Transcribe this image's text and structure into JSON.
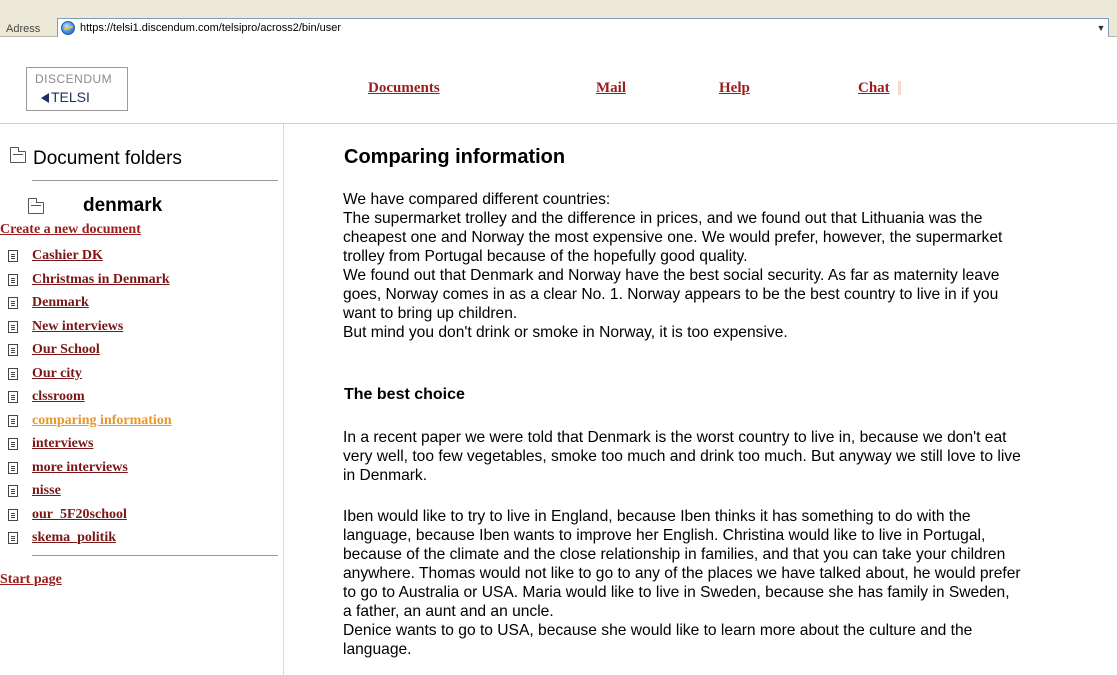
{
  "browser": {
    "address_label": "Adress",
    "url": "https://telsi1.discendum.com/telsipro/across2/bin/user"
  },
  "header": {
    "logo": {
      "line1": "DISCENDUM",
      "line2": "TELSI"
    },
    "nav": [
      {
        "label": "Documents"
      },
      {
        "label": "Mail"
      },
      {
        "label": "Help"
      },
      {
        "label": "Chat"
      }
    ]
  },
  "sidebar": {
    "title": "Document folders",
    "current_folder": "denmark",
    "create_link": "Create a new document",
    "documents": [
      {
        "label": "Cashier DK",
        "active": false
      },
      {
        "label": "Christmas in Denmark",
        "active": false
      },
      {
        "label": "Denmark",
        "active": false
      },
      {
        "label": "New interviews",
        "active": false
      },
      {
        "label": "Our School",
        "active": false
      },
      {
        "label": "Our city",
        "active": false
      },
      {
        "label": "clssroom",
        "active": false
      },
      {
        "label": "comparing information",
        "active": true
      },
      {
        "label": "interviews",
        "active": false
      },
      {
        "label": "more interviews",
        "active": false
      },
      {
        "label": "nisse",
        "active": false
      },
      {
        "label": "our_5F20school",
        "active": false
      },
      {
        "label": "skema_politik",
        "active": false
      }
    ],
    "start_link": "Start page"
  },
  "article": {
    "title": "Comparing information",
    "intro": [
      "We have compared different countries:",
      "The supermarket trolley and the difference in prices, and we found out that Lithuania was the",
      "cheapest one and Norway the most expensive one. We would prefer, however, the supermarket",
      "trolley from Portugal because of the hopefully good quality.",
      "We found out that Denmark and Norway have the best social security. As far as maternity leave",
      "goes, Norway comes in as a clear No. 1. Norway appears to be the best country to live in if you",
      "want to bring up children.",
      "But mind you don't drink or smoke in Norway, it is too expensive."
    ],
    "subtitle": "The best choice",
    "para2": [
      "In a recent paper we were told that Denmark is the worst country to live in, because we don't eat",
      "very well, too few vegetables, smoke too much and drink too much. But anyway we still love to live",
      "in Denmark."
    ],
    "para3": [
      "Iben would like to try to live in England, because Iben thinks it has something to do with the",
      "language, because Iben wants to improve her English. Christina would like to live in Portugal,",
      "because of the climate and the close relationship in families, and that you can take your children",
      "anywhere. Thomas would not like to go to any of the places we have talked about, he would prefer",
      "to go to Australia or USA. Maria would like to live in Sweden, because she has family in Sweden,",
      "a father, an aunt and an uncle.",
      "Denice wants to go to USA, because she would like to learn more about the culture and the",
      "language."
    ]
  }
}
